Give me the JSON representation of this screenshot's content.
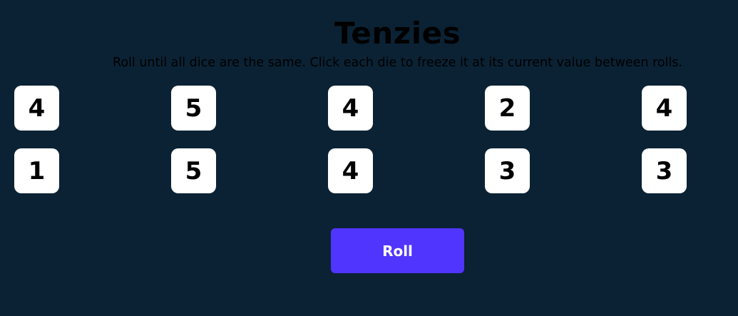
{
  "header": {
    "title": "Tenzies",
    "instructions": "Roll until all dice are the same. Click each die to freeze it at its current value between rolls."
  },
  "dice": [
    {
      "value": "4"
    },
    {
      "value": "5"
    },
    {
      "value": "4"
    },
    {
      "value": "2"
    },
    {
      "value": "4"
    },
    {
      "value": "1"
    },
    {
      "value": "5"
    },
    {
      "value": "4"
    },
    {
      "value": "3"
    },
    {
      "value": "3"
    }
  ],
  "controls": {
    "roll_label": "Roll"
  },
  "colors": {
    "background": "#0b2234",
    "die": "#ffffff",
    "button": "#5035ff"
  }
}
